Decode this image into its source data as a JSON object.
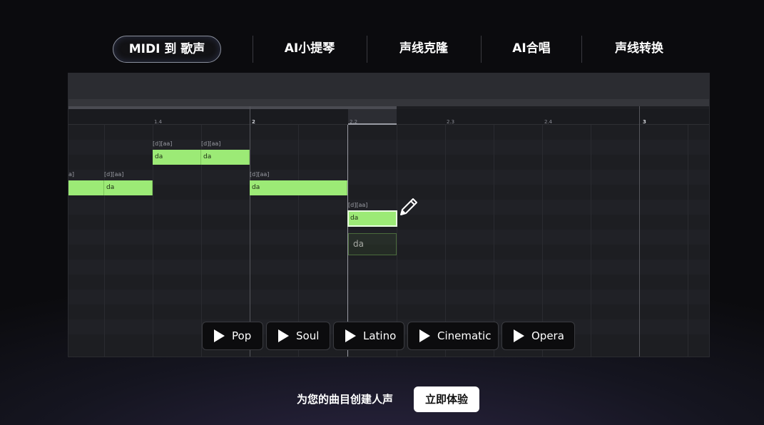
{
  "tabs": [
    {
      "label": "MIDI 到 歌声"
    },
    {
      "label": "AI小提琴"
    },
    {
      "label": "声线克隆"
    },
    {
      "label": "AI合唱"
    },
    {
      "label": "声线转换"
    }
  ],
  "ruler": {
    "labels": [
      "1.4",
      "2",
      "2.2",
      "2.3",
      "2.4",
      "3"
    ]
  },
  "notes": [
    {
      "tag": "a]",
      "lyric": ""
    },
    {
      "tag": "[d][aa]",
      "lyric": "da"
    },
    {
      "tag": "[d][aa]",
      "lyric": "da"
    },
    {
      "tag": "[d][aa]",
      "lyric": "da"
    },
    {
      "tag": "[d][aa]",
      "lyric": "da"
    },
    {
      "tag": "[d][aa]",
      "lyric": "da"
    }
  ],
  "ghost_note": {
    "lyric": "da"
  },
  "styles": [
    {
      "label": "Pop"
    },
    {
      "label": "Soul"
    },
    {
      "label": "Latino"
    },
    {
      "label": "Cinematic"
    },
    {
      "label": "Opera"
    }
  ],
  "cta": {
    "text": "为您的曲目创建人声",
    "button": "立即体验"
  },
  "colors": {
    "note": "#9cea76",
    "background": "#0c0c0f"
  }
}
